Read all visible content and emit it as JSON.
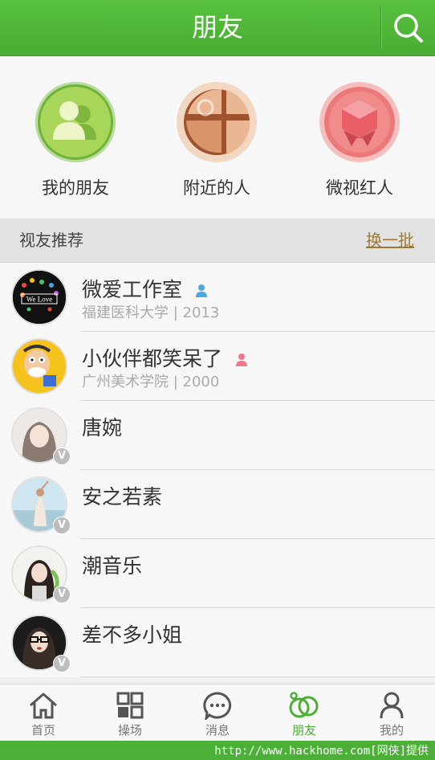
{
  "header": {
    "title": "朋友"
  },
  "categories": [
    {
      "label": "我的朋友",
      "icon": "friends-icon"
    },
    {
      "label": "附近的人",
      "icon": "map-pin-icon"
    },
    {
      "label": "微视红人",
      "icon": "gem-badge-icon"
    }
  ],
  "recommend": {
    "title": "视友推荐",
    "refresh": "换一批"
  },
  "users": [
    {
      "name": "微爱工作室",
      "sub": "福建医科大学 | 2013",
      "gender": "male"
    },
    {
      "name": "小伙伴都笑呆了",
      "sub": "广州美术学院 | 2000",
      "gender": "female"
    },
    {
      "name": "唐婉",
      "sub": "",
      "verified": "V"
    },
    {
      "name": "安之若素",
      "sub": "",
      "verified": "V"
    },
    {
      "name": "潮音乐",
      "sub": "",
      "verified": "V"
    },
    {
      "name": "差不多小姐",
      "sub": "",
      "verified": "V"
    }
  ],
  "avatar_text": {
    "we_love": "We Love"
  },
  "tabs": [
    {
      "label": "首页",
      "icon": "home-icon"
    },
    {
      "label": "操场",
      "icon": "grid-icon"
    },
    {
      "label": "消息",
      "icon": "message-icon"
    },
    {
      "label": "朋友",
      "icon": "friends-rings-icon",
      "active": true
    },
    {
      "label": "我的",
      "icon": "person-icon"
    }
  ],
  "footer": {
    "text": "http://www.hackhome.com[网侠]提供"
  },
  "colors": {
    "brand_green": "#4cae36",
    "link_gold": "#9a7a36"
  }
}
